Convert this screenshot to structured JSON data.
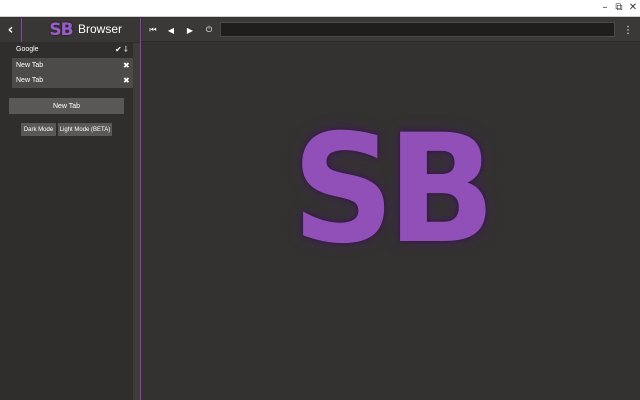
{
  "window": {
    "controls": {
      "minimize": "–",
      "maximize": "⧉",
      "close": "✕"
    }
  },
  "sidebar": {
    "back_icon": "‹",
    "logo": "SB",
    "title": "Browser",
    "tabs": [
      {
        "label": "Google",
        "check_icon": "✔",
        "pin_icon": "⸸"
      },
      {
        "label": "New Tab",
        "close_icon": "✖"
      },
      {
        "label": "New Tab",
        "close_icon": "✖"
      }
    ],
    "new_tab_label": "New Tab",
    "dark_mode_label": "Dark Mode",
    "light_mode_label": "Light Mode (BETA)"
  },
  "toolbar": {
    "home_icon": "⏮",
    "back_icon": "◀",
    "forward_icon": "▶",
    "reload_icon": "⏻",
    "url_value": "",
    "menu_icon": "⋮"
  },
  "content": {
    "logo": "SB"
  },
  "colors": {
    "accent": "#9050b8",
    "background": "#333230",
    "sidebar_bg": "#2f2e2c",
    "button_bg": "#595856"
  }
}
